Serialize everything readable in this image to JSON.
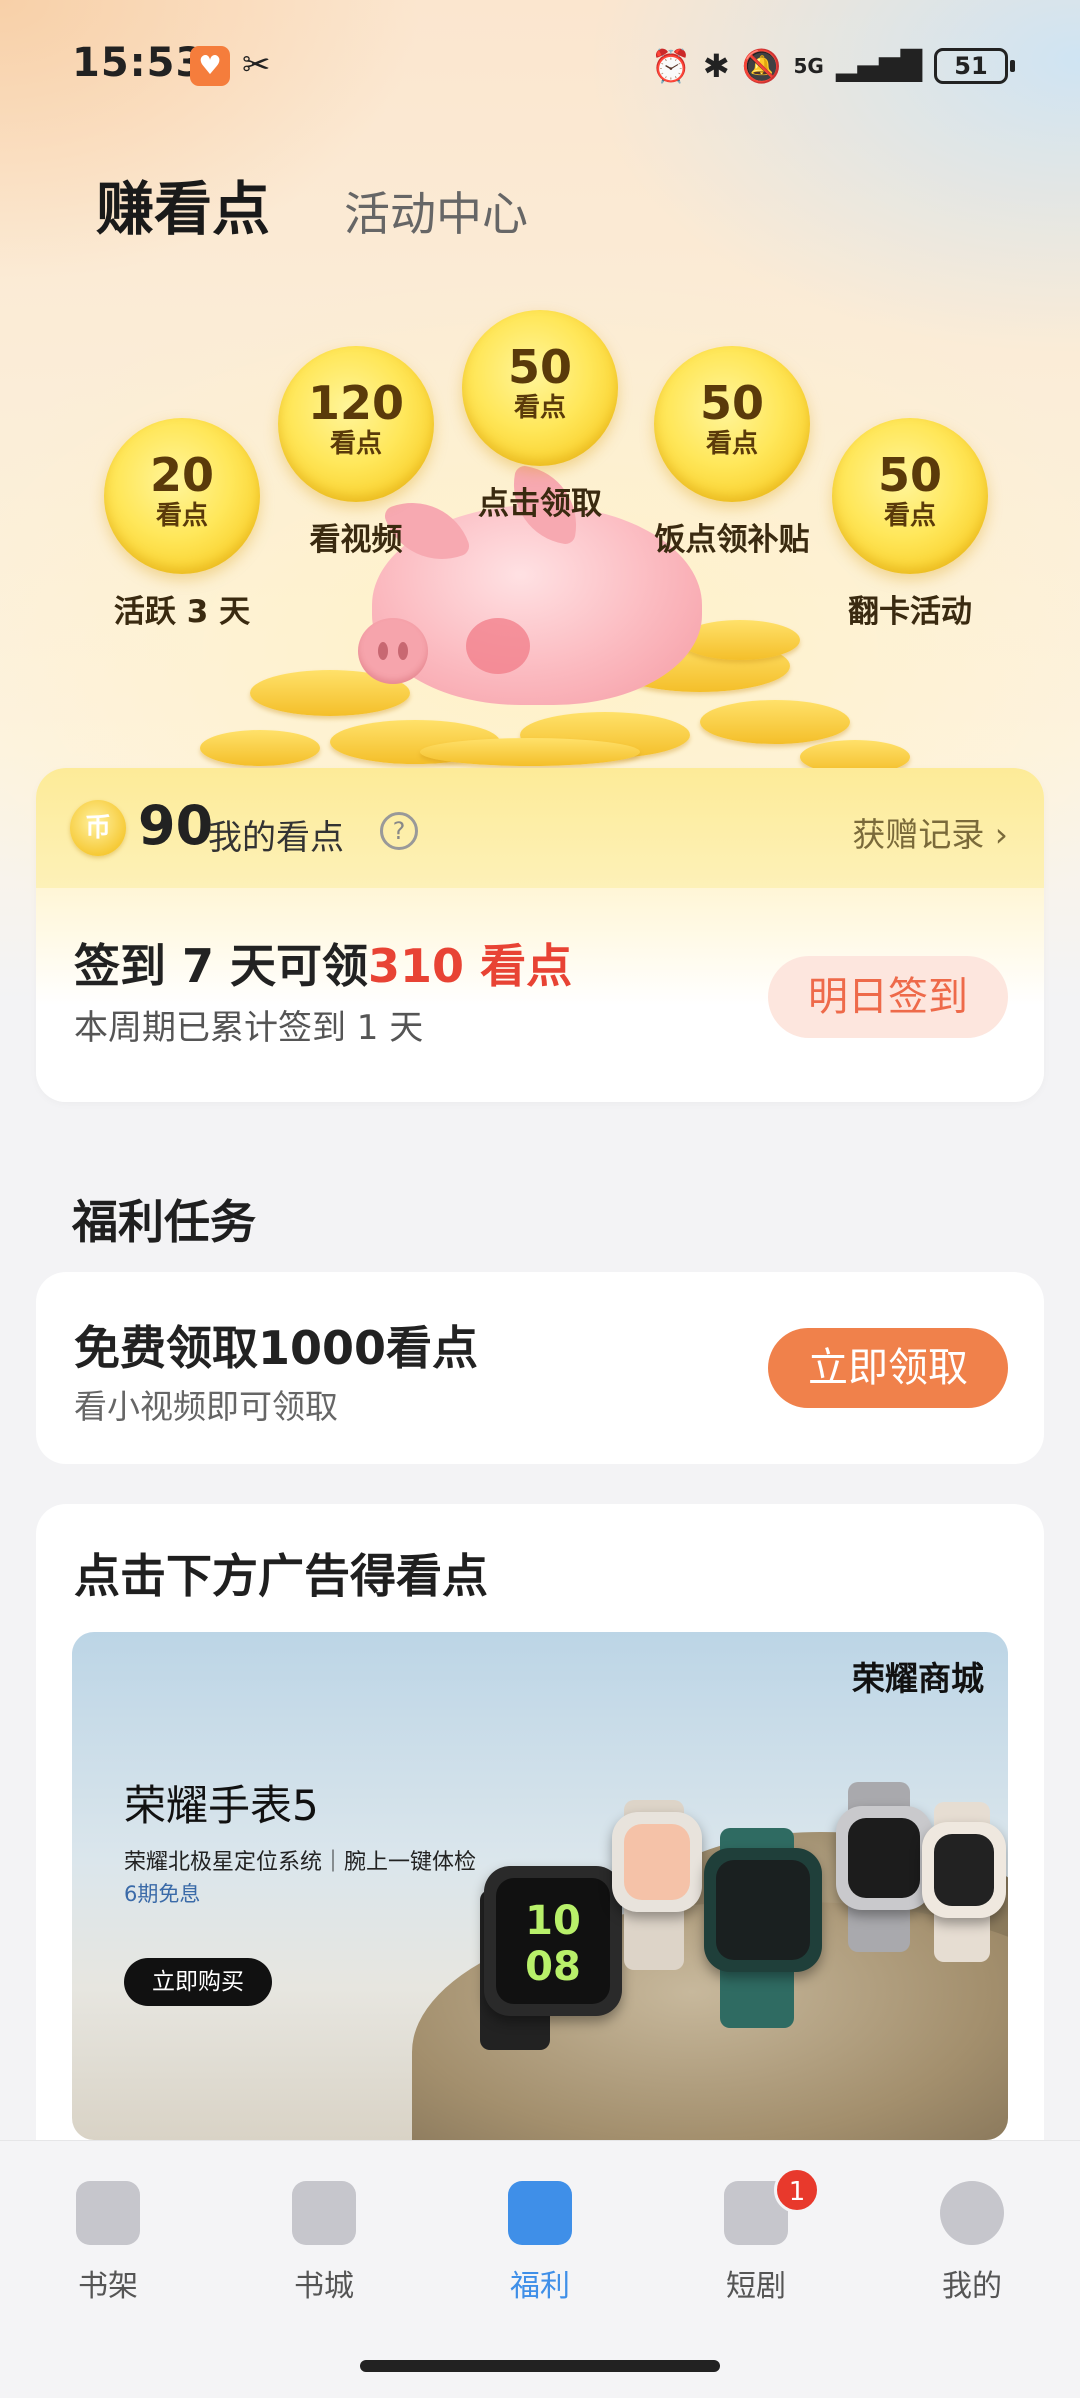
{
  "status_bar": {
    "time": "15:53",
    "signal_label": "5G",
    "battery": "51",
    "icons": [
      "app-badge-icon",
      "link-icon",
      "alarm-icon",
      "bluetooth-icon",
      "mute-bell-icon",
      "signal-icon",
      "battery-icon"
    ]
  },
  "tabs": {
    "active": "赚看点",
    "inactive": "活动中心"
  },
  "coins": [
    {
      "value": "20",
      "unit": "看点",
      "label": "活跃 3 天"
    },
    {
      "value": "120",
      "unit": "看点",
      "label": "看视频"
    },
    {
      "value": "50",
      "unit": "看点",
      "label": "点击领取"
    },
    {
      "value": "50",
      "unit": "看点",
      "label": "饭点领补贴"
    },
    {
      "value": "50",
      "unit": "看点",
      "label": "翻卡活动"
    }
  ],
  "points": {
    "coin_glyph": "币",
    "value": "90",
    "label": "我的看点",
    "help_glyph": "?",
    "history_link": "获赠记录 ›"
  },
  "signin": {
    "title_prefix": "签到 7 天可领",
    "title_highlight": "310 看点",
    "subtitle": "本周期已累计签到 1 天",
    "button": "明日签到"
  },
  "tasks": {
    "section_title": "福利任务",
    "items": [
      {
        "title": "免费领取1000看点",
        "subtitle": "看小视频即可领取",
        "button": "立即领取"
      }
    ]
  },
  "ad": {
    "title": "点击下方广告得看点",
    "brand": "荣耀商城",
    "product": "荣耀手表5",
    "slogan": "荣耀北极星定位系统｜腕上一键体检",
    "promo": "6期免息",
    "cta": "立即购买",
    "watch_time": "10 08"
  },
  "bottom_nav": {
    "items": [
      {
        "label": "书架",
        "icon": "bookshelf-icon",
        "active": false
      },
      {
        "label": "书城",
        "icon": "bookstore-icon",
        "active": false
      },
      {
        "label": "福利",
        "icon": "gift-icon",
        "active": true
      },
      {
        "label": "短剧",
        "icon": "short-drama-icon",
        "active": false,
        "badge": "1"
      },
      {
        "label": "我的",
        "icon": "profile-icon",
        "active": false
      }
    ]
  },
  "colors": {
    "accent_orange": "#f0814b",
    "highlight_red": "#e84334",
    "active_blue": "#3f8fe8",
    "coin_gold": "#ffe75a"
  }
}
